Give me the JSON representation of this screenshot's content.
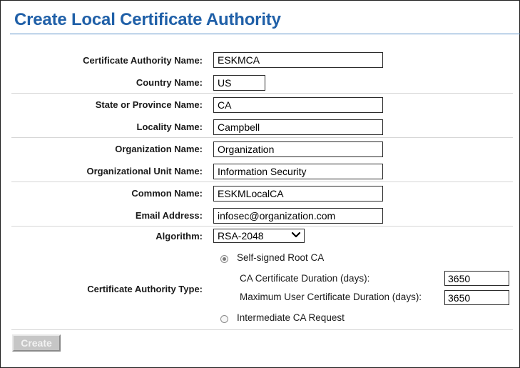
{
  "page": {
    "title": "Create Local Certificate Authority"
  },
  "form": {
    "ca_name": {
      "label": "Certificate Authority Name:",
      "value": "ESKMCA"
    },
    "country": {
      "label": "Country Name:",
      "value": "US"
    },
    "state": {
      "label": "State or Province Name:",
      "value": "CA"
    },
    "locality": {
      "label": "Locality Name:",
      "value": "Campbell"
    },
    "organization": {
      "label": "Organization Name:",
      "value": "Organization"
    },
    "org_unit": {
      "label": "Organizational Unit Name:",
      "value": "Information Security"
    },
    "common_name": {
      "label": "Common Name:",
      "value": "ESKMLocalCA"
    },
    "email": {
      "label": "Email Address:",
      "value": "infosec@organization.com"
    },
    "algorithm": {
      "label": "Algorithm:",
      "selected": "RSA-2048"
    },
    "ca_type": {
      "label": "Certificate Authority Type:",
      "self_signed_label": "Self-signed Root CA",
      "self_signed_selected": true,
      "ca_duration_label": "CA Certificate Duration (days):",
      "ca_duration_value": "3650",
      "max_user_duration_label": "Maximum User Certificate Duration (days):",
      "max_user_duration_value": "3650",
      "intermediate_label": "Intermediate CA Request",
      "intermediate_selected": false
    }
  },
  "buttons": {
    "create_label": "Create",
    "create_disabled": true
  },
  "colors": {
    "title": "#2060a8",
    "rule": "#5a90c8",
    "button_disabled": "#c6c6c6"
  },
  "icons": {
    "select_arrow": "chevron-down-icon"
  }
}
